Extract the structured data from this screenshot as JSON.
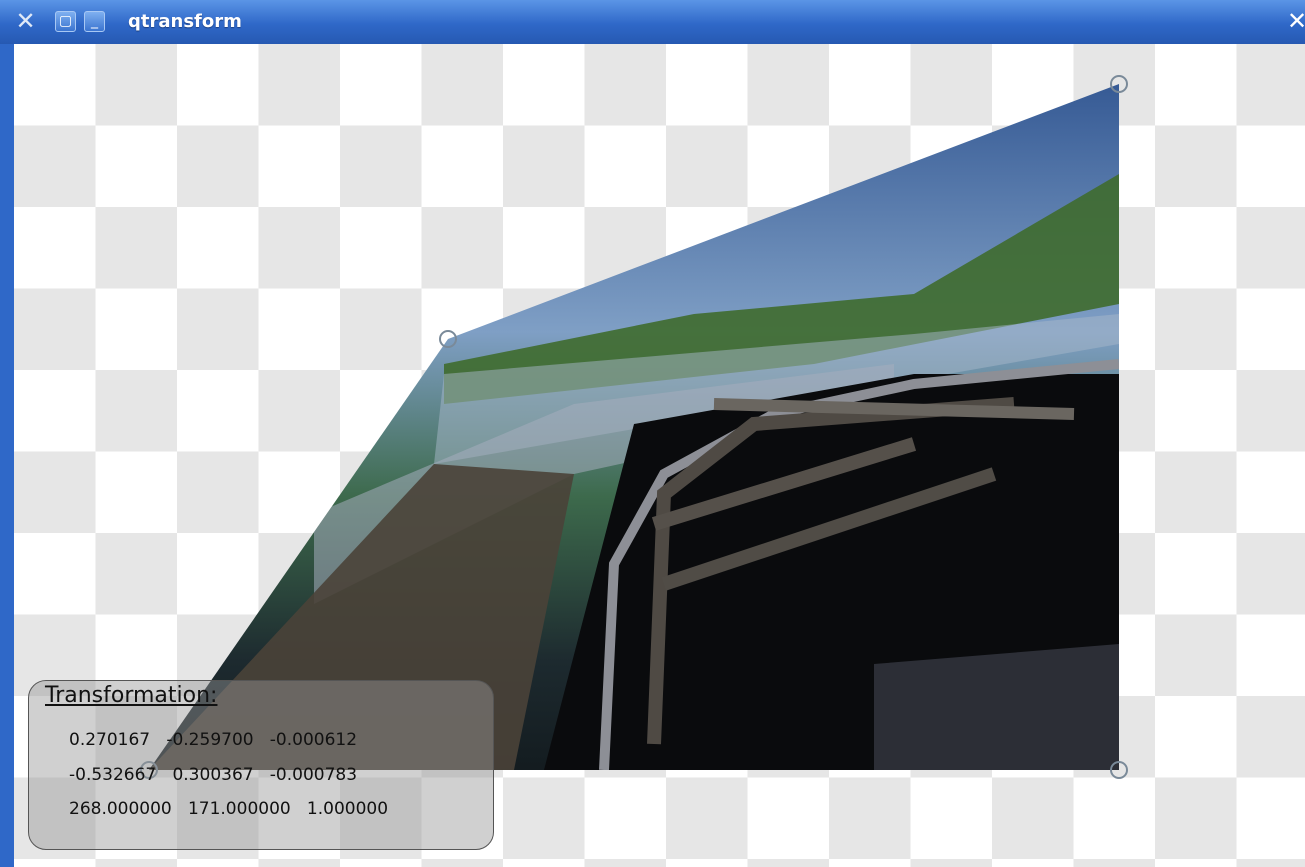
{
  "window": {
    "title": "qtransform",
    "buttons": {
      "close_icon": "x-icon",
      "maximize_icon": "square-icon",
      "minimize_icon": "minimize-icon",
      "right_close": "✕"
    }
  },
  "canvas": {
    "checker_light": "#ffffff",
    "checker_dark": "#e6e6e6",
    "image_subject": "lake and rowboat landscape photo (perspective-transformed)"
  },
  "transformation": {
    "title": "Transformation:",
    "rows": [
      "0.270167   -0.259700   -0.000612",
      "-0.532667   0.300367   -0.000783",
      "268.000000   171.000000   1.000000"
    ]
  }
}
